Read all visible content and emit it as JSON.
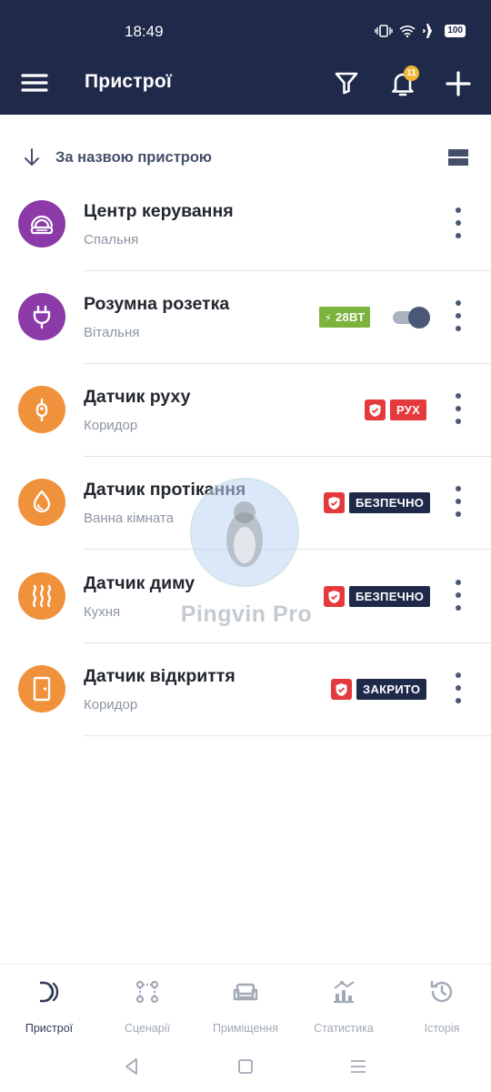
{
  "status_bar": {
    "time": "18:49",
    "battery": "100"
  },
  "app_bar": {
    "title": "Пристрої",
    "notification_count": "11",
    "icons": [
      "menu-icon",
      "filter-icon",
      "bell-icon",
      "plus-icon"
    ]
  },
  "sort": {
    "label": "За назвою пристрою"
  },
  "devices": [
    {
      "name": "Центр керування",
      "room": "Спальня",
      "icon": "hub-icon",
      "color": "#8b3aa7"
    },
    {
      "name": "Розумна розетка",
      "room": "Вітальня",
      "icon": "plug-icon",
      "color": "#8b3aa7",
      "power": "28ВТ",
      "toggle_on": true
    },
    {
      "name": "Датчик руху",
      "room": "Коридор",
      "icon": "motion-icon",
      "color": "#f0913c",
      "status": "РУХ",
      "status_color": "#e43a3d"
    },
    {
      "name": "Датчик протікання",
      "room": "Ванна кімната",
      "icon": "water-drop-icon",
      "color": "#f0913c",
      "status": "БЕЗПЕЧНО",
      "status_color": "#1f2a4a"
    },
    {
      "name": "Датчик диму",
      "room": "Кухня",
      "icon": "smoke-icon",
      "color": "#f0913c",
      "status": "БЕЗПЕЧНО",
      "status_color": "#1f2a4a"
    },
    {
      "name": "Датчик відкриття",
      "room": "Коридор",
      "icon": "door-icon",
      "color": "#f0913c",
      "status": "ЗАКРИТО",
      "status_color": "#1f2a4a"
    }
  ],
  "watermark": {
    "text": "Pingvin Pro"
  },
  "bottom_nav": {
    "items": [
      {
        "label": "Пристрої",
        "icon": "devices-icon",
        "active": true
      },
      {
        "label": "Сценарії",
        "icon": "scenarios-icon",
        "active": false
      },
      {
        "label": "Приміщення",
        "icon": "rooms-icon",
        "active": false
      },
      {
        "label": "Статистика",
        "icon": "statistics-icon",
        "active": false
      },
      {
        "label": "Історія",
        "icon": "history-icon",
        "active": false
      }
    ]
  },
  "colors": {
    "header": "#1f2a4a",
    "purple": "#8b3aa7",
    "orange": "#f0913c",
    "alert_red": "#e43a3d",
    "power_green": "#7bb33d"
  }
}
